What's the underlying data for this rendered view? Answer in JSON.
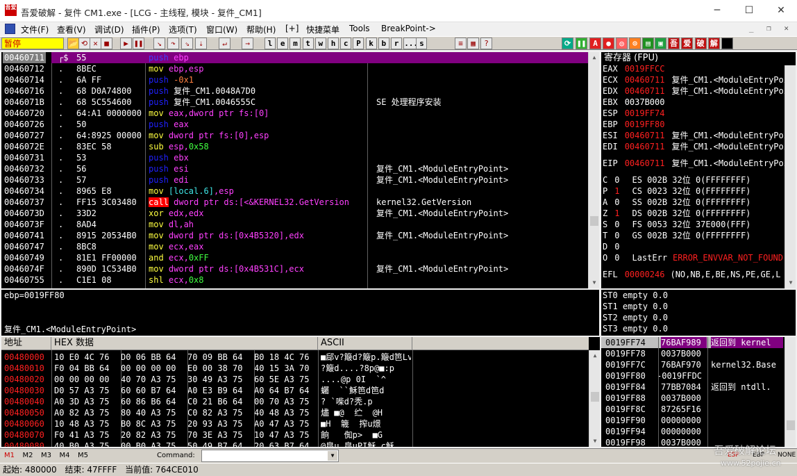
{
  "window": {
    "title": "吾爱破解 - 复件 CM1.exe - [LCG - 主线程, 模块 - 复件_CM1]",
    "icon_text": "吾爱"
  },
  "menu": [
    "文件(F)",
    "查看(V)",
    "调试(D)",
    "插件(P)",
    "选项(T)",
    "窗口(W)",
    "帮助(H)",
    "[+]",
    "快捷菜单",
    "Tools",
    "BreakPoint->"
  ],
  "toolbar": {
    "status": "暂停",
    "letters": [
      "l",
      "e",
      "m",
      "t",
      "w",
      "h",
      "c",
      "P",
      "k",
      "b",
      "r",
      "...",
      "s"
    ],
    "right_buttons": [
      "A",
      "吾",
      "爱",
      "破",
      "解"
    ]
  },
  "disasm": {
    "rows": [
      {
        "addr": "00460711",
        "dot": "┌$",
        "hex": "55",
        "ins": [
          [
            "push",
            "m"
          ],
          [
            " ebp",
            "r"
          ]
        ],
        "cmt": ""
      },
      {
        "addr": "00460712",
        "dot": ".",
        "hex": "8BEC",
        "ins": [
          [
            "mov",
            "y"
          ],
          [
            " ebp,esp",
            "r"
          ]
        ],
        "cmt": ""
      },
      {
        "addr": "00460714",
        "dot": ".",
        "hex": "6A FF",
        "ins": [
          [
            "push",
            "m"
          ],
          [
            " -0x1",
            "n"
          ]
        ],
        "cmt": ""
      },
      {
        "addr": "00460716",
        "dot": ".",
        "hex": "68 D0A74800",
        "ins": [
          [
            "push",
            "m"
          ],
          [
            " 复件_CM1.0048A7D0",
            "w"
          ]
        ],
        "cmt": ""
      },
      {
        "addr": "0046071B",
        "dot": ".",
        "hex": "68 5C554600",
        "ins": [
          [
            "push",
            "m"
          ],
          [
            " 复件_CM1.0046555C",
            "w"
          ]
        ],
        "cmt": "SE 处理程序安装"
      },
      {
        "addr": "00460720",
        "dot": ".",
        "hex": "64:A1 0000000",
        "ins": [
          [
            "mov",
            "y"
          ],
          [
            " eax,",
            "r"
          ],
          [
            "dword ptr fs:[0]",
            "r"
          ]
        ],
        "cmt": ""
      },
      {
        "addr": "00460726",
        "dot": ".",
        "hex": "50",
        "ins": [
          [
            "push",
            "m"
          ],
          [
            " eax",
            "r"
          ]
        ],
        "cmt": ""
      },
      {
        "addr": "00460727",
        "dot": ".",
        "hex": "64:8925 00000",
        "ins": [
          [
            "mov",
            "y"
          ],
          [
            " dword ptr fs:[0],esp",
            "r"
          ]
        ],
        "cmt": ""
      },
      {
        "addr": "0046072E",
        "dot": ".",
        "hex": "83EC 58",
        "ins": [
          [
            "sub",
            "y"
          ],
          [
            " esp,",
            "r"
          ],
          [
            "0x58",
            "g"
          ]
        ],
        "cmt": ""
      },
      {
        "addr": "00460731",
        "dot": ".",
        "hex": "53",
        "ins": [
          [
            "push",
            "m"
          ],
          [
            " ebx",
            "r"
          ]
        ],
        "cmt": ""
      },
      {
        "addr": "00460732",
        "dot": ".",
        "hex": "56",
        "ins": [
          [
            "push",
            "m"
          ],
          [
            " esi",
            "r"
          ]
        ],
        "cmt": "复件_CM1.<ModuleEntryPoint>"
      },
      {
        "addr": "00460733",
        "dot": ".",
        "hex": "57",
        "ins": [
          [
            "push",
            "m"
          ],
          [
            " edi",
            "r"
          ]
        ],
        "cmt": "复件_CM1.<ModuleEntryPoint>"
      },
      {
        "addr": "00460734",
        "dot": ".",
        "hex": "8965 E8",
        "ins": [
          [
            "mov",
            "y"
          ],
          [
            " [local.6]",
            "c"
          ],
          [
            ",esp",
            "r"
          ]
        ],
        "cmt": ""
      },
      {
        "addr": "00460737",
        "dot": ".",
        "hex": "FF15 3C03480",
        "ins": [
          [
            "call",
            "k"
          ],
          [
            " dword ptr ds:[<&KERNEL32.GetVersion",
            "r"
          ]
        ],
        "cmt": "kernel32.GetVersion"
      },
      {
        "addr": "0046073D",
        "dot": ".",
        "hex": "33D2",
        "ins": [
          [
            "xor",
            "y"
          ],
          [
            " edx,edx",
            "r"
          ]
        ],
        "cmt": "复件_CM1.<ModuleEntryPoint>"
      },
      {
        "addr": "0046073F",
        "dot": ".",
        "hex": "8AD4",
        "ins": [
          [
            "mov",
            "y"
          ],
          [
            " dl,ah",
            "r"
          ]
        ],
        "cmt": ""
      },
      {
        "addr": "00460741",
        "dot": ".",
        "hex": "8915 20534B0",
        "ins": [
          [
            "mov",
            "y"
          ],
          [
            " dword ptr ds:[0x4B5320],edx",
            "r"
          ]
        ],
        "cmt": "复件_CM1.<ModuleEntryPoint>"
      },
      {
        "addr": "00460747",
        "dot": ".",
        "hex": "8BC8",
        "ins": [
          [
            "mov",
            "y"
          ],
          [
            " ecx,eax",
            "r"
          ]
        ],
        "cmt": ""
      },
      {
        "addr": "00460749",
        "dot": ".",
        "hex": "81E1 FF00000",
        "ins": [
          [
            "and",
            "y"
          ],
          [
            " ecx,",
            "r"
          ],
          [
            "0xFF",
            "g"
          ]
        ],
        "cmt": ""
      },
      {
        "addr": "0046074F",
        "dot": ".",
        "hex": "890D 1C534B0",
        "ins": [
          [
            "mov",
            "y"
          ],
          [
            " dword ptr ds:[0x4B531C],ecx",
            "r"
          ]
        ],
        "cmt": "复件_CM1.<ModuleEntryPoint>"
      },
      {
        "addr": "00460755",
        "dot": ".",
        "hex": "C1E1 08",
        "ins": [
          [
            "shl",
            "y"
          ],
          [
            " ecx,",
            "r"
          ],
          [
            "0x8",
            "g"
          ]
        ],
        "cmt": ""
      }
    ],
    "info1": "ebp=0019FF80",
    "info2": "复件_CM1.<ModuleEntryPoint>"
  },
  "registers": {
    "title": "寄存器 (FPU)",
    "gp": [
      {
        "n": "EAX",
        "v": "0019FFCC",
        "red": true,
        "c": ""
      },
      {
        "n": "ECX",
        "v": "00460711",
        "red": true,
        "c": "复件_CM1.<ModuleEntryPoint>"
      },
      {
        "n": "EDX",
        "v": "00460711",
        "red": true,
        "c": "复件_CM1.<ModuleEntryPoint>"
      },
      {
        "n": "EBX",
        "v": "0037B000",
        "red": false,
        "c": ""
      },
      {
        "n": "ESP",
        "v": "0019FF74",
        "red": true,
        "c": ""
      },
      {
        "n": "EBP",
        "v": "0019FF80",
        "red": true,
        "c": ""
      },
      {
        "n": "ESI",
        "v": "00460711",
        "red": true,
        "c": "复件_CM1.<ModuleEntryPoint>"
      },
      {
        "n": "EDI",
        "v": "00460711",
        "red": true,
        "c": "复件_CM1.<ModuleEntryPoint>"
      }
    ],
    "eip": {
      "n": "EIP",
      "v": "00460711",
      "c": "复件_CM1.<ModuleEntryPoint>"
    },
    "flags": [
      {
        "f": "C",
        "v": "0",
        "red": false,
        "s": "ES 002B 32位 0(FFFFFFFF)"
      },
      {
        "f": "P",
        "v": "1",
        "red": true,
        "s": "CS 0023 32位 0(FFFFFFFF)"
      },
      {
        "f": "A",
        "v": "0",
        "red": false,
        "s": "SS 002B 32位 0(FFFFFFFF)"
      },
      {
        "f": "Z",
        "v": "1",
        "red": true,
        "s": "DS 002B 32位 0(FFFFFFFF)"
      },
      {
        "f": "S",
        "v": "0",
        "red": false,
        "s": "FS 0053 32位 37E000(FFF)"
      },
      {
        "f": "T",
        "v": "0",
        "red": false,
        "s": "GS 002B 32位 0(FFFFFFFF)"
      },
      {
        "f": "D",
        "v": "0",
        "red": false,
        "s": ""
      },
      {
        "f": "O",
        "v": "0",
        "red": false,
        "s": "LastErr"
      }
    ],
    "lasterr": "ERROR_ENVVAR_NOT_FOUND",
    "efl": "EFL",
    "efl_v": "00000246",
    "efl_c": "(NO,NB,E,BE,NS,PE,GE,L",
    "st": [
      "ST0 empty 0.0",
      "ST1 empty 0.0",
      "ST2 empty 0.0",
      "ST3 empty 0.0"
    ]
  },
  "dump": {
    "h_addr": "地址",
    "h_hex": "HEX 数据",
    "h_ascii": "ASCII",
    "rows": [
      [
        "00480000",
        "10 E0 4C 76|D0 06 BB 64|70 09 BB 64|B0 18 4C 76",
        "■郈v?簸d?簸p.簸d笆Lv"
      ],
      [
        "00480010",
        "F0 04 BB 64|00 00 00 00|E0 00 38 70|40 15 3A 70",
        "?簸d....?8p@■:p"
      ],
      [
        "00480020",
        "00 00 00 00|40 70 A3 75|30 49 A3 75|60 5E A3 75",
        "....@p 0I  `^"
      ],
      [
        "00480030",
        "D0 57 A3 75|60 60 B7 64|A0 E3 B9 64|A0 64 B7 64",
        "蠾  ``穌笆d笆d"
      ],
      [
        "00480040",
        "A0 3D A3 75|60 86 B6 64|C0 21 B6 64|00 70 A3 75",
        "? `喍d?秃.p"
      ],
      [
        "00480050",
        "A0 82 A3 75|80 40 A3 75|C0 82 A3 75|40 48 A3 75",
        "燼 ■@  纻  @H"
      ],
      [
        "00480060",
        "10 48 A3 75|B0 8C A3 75|20 93 A3 75|A0 47 A3 75",
        "■H  簚  搾u燝"
      ],
      [
        "00480070",
        "F0 41 A3 75|20 82 A3 75|70 3E A3 75|10 47 A3 75",
        "餉   倁p>  ■G"
      ],
      [
        "00480080",
        "40 B0 A3 75|00 B0 A3 75|50 49 B7 64|20 63 B7 64",
        "@皍u 皍uPI穌 c穌"
      ]
    ]
  },
  "stack": {
    "rows": [
      [
        "0019FF74",
        "76BAF989",
        "返回到 kernel"
      ],
      [
        "0019FF78",
        "0037B000",
        ""
      ],
      [
        "0019FF7C",
        "76BAF970",
        "kernel32.Base"
      ],
      [
        "0019FF80",
        "-0019FFDC",
        ""
      ],
      [
        "0019FF84",
        "77BB7084",
        "返回到 ntdll."
      ],
      [
        "0019FF88",
        "0037B000",
        ""
      ],
      [
        "0019FF8C",
        "87265F16",
        ""
      ],
      [
        "0019FF90",
        "00000000",
        ""
      ],
      [
        "0019FF94",
        "00000000",
        ""
      ],
      [
        "0019FF98",
        "0037B000",
        ""
      ]
    ]
  },
  "cmd": {
    "tabs": [
      "M1",
      "M2",
      "M3",
      "M4",
      "M5"
    ],
    "label": "Command:",
    "right": [
      "ESP",
      "EBP",
      "NONE"
    ]
  },
  "status": {
    "start": "起始: 480000",
    "end": "结束: 47FFFF",
    "cur": "当前值: 764CE010"
  },
  "watermark": {
    "cn": "吾爱破解论坛",
    "url": "www.52pojie.cn"
  },
  "colors": {
    "bg": "#000000",
    "sel": "#808080",
    "red": "#ff2020",
    "push": "#2020ff",
    "mov": "#ffff40"
  }
}
